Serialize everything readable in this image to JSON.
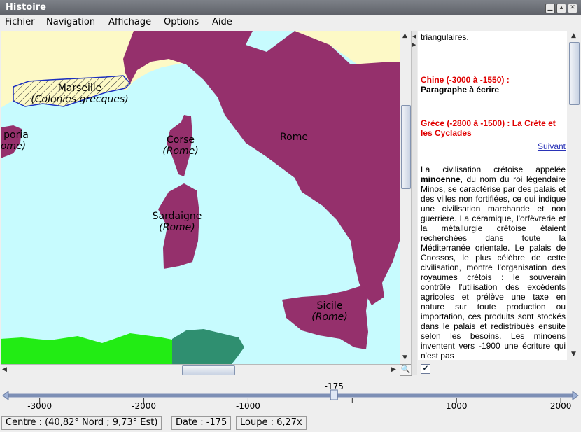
{
  "window": {
    "title": "Histoire"
  },
  "menu": {
    "items": [
      "Fichier",
      "Navigation",
      "Affichage",
      "Options",
      "Aide"
    ]
  },
  "map": {
    "labels": [
      {
        "name": "Marseille",
        "sub": "(Colonies grecques)"
      },
      {
        "name": "Corse",
        "sub": "(Rome)"
      },
      {
        "name": "Rome",
        "sub": ""
      },
      {
        "name": "Sardaigne",
        "sub": "(Rome)"
      },
      {
        "name": "Sicile",
        "sub": "(Rome)"
      },
      {
        "name": "poria",
        "sub": "ome)"
      }
    ],
    "colors": {
      "sea": "#c7fbfe",
      "land": "#fdf9c6",
      "rome": "#95306c",
      "greek_colony_outline": "#1b2fbf",
      "green": "#22ec14",
      "dark_green": "#2f8f70"
    }
  },
  "text": {
    "top_fragment": "triangulaires.",
    "chine_title": "Chine (-3000 à -1550) :",
    "chine_body": "Paragraphe à écrire",
    "grece_title": "Grèce (-2800 à -1500) : La Crète et les Cyclades",
    "suivant": "Suivant",
    "para_start": "La civilisation crétoise appelée ",
    "para_bold": "minoenne",
    "para_rest": ", du nom du roi légendaire Minos, se caractérise par des palais et des villes non fortifiées, ce qui indique une civilisation marchande et non guerrière. La céramique, l'orfèvrerie et la métallurgie crétoise étaient recherchées dans toute la Méditerranée orientale. Le palais de Cnossos, le plus célèbre de cette civilisation, montre l'organisation des royaumes crétois : le souverain contrôle l'utilisation des excédents agricoles et prélève une taxe en nature sur toute production ou importation, ces produits sont stockés dans le palais et redistribués ensuite selon les besoins. Les minoens inventent vers -1900 une écriture qui n'est pas"
  },
  "timeline": {
    "current_label": "-175",
    "current_value": -175,
    "min": -3300,
    "max": 2100,
    "ticks": [
      -3000,
      -2000,
      -1000,
      1000,
      2000
    ],
    "tick_labels": [
      "-3000",
      "-2000",
      "-1000",
      "1000",
      "2000"
    ]
  },
  "status": {
    "centre": "Centre : (40,82° Nord ; 9,73° Est)",
    "date": "Date : -175",
    "loupe": "Loupe : 6,27x"
  }
}
